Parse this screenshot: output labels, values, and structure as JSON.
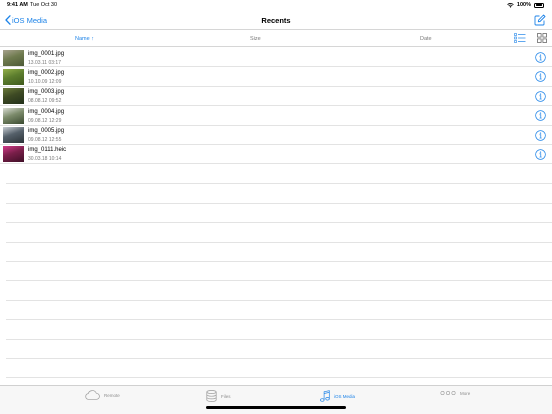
{
  "status_bar": {
    "time": "9:41 AM",
    "date": "Tue Oct 30",
    "battery": "100%",
    "battery_level": 1.0
  },
  "nav": {
    "back_label": "iOS Media",
    "title": "Recents"
  },
  "columns": {
    "name": "Name ↑",
    "size": "Size",
    "date": "Date"
  },
  "files": [
    {
      "name": "img_0001.jpg",
      "date": "13.03.11 03:17",
      "thumb_colors": [
        "#6f7b4f",
        "#a8a38f",
        "#4d5a36"
      ]
    },
    {
      "name": "img_0002.jpg",
      "date": "10.10.09 12:09",
      "thumb_colors": [
        "#5d7e2e",
        "#94b04a",
        "#3f5a1c"
      ]
    },
    {
      "name": "img_0003.jpg",
      "date": "08.08.12 09:52",
      "thumb_colors": [
        "#3e4a24",
        "#6a7a3a",
        "#22301a"
      ]
    },
    {
      "name": "img_0004.jpg",
      "date": "09.08.12 12:29",
      "thumb_colors": [
        "#7b8a6a",
        "#d9dcd3",
        "#3a4a30"
      ]
    },
    {
      "name": "img_0005.jpg",
      "date": "09.08.12 12:55",
      "thumb_colors": [
        "#55606a",
        "#c7cdd3",
        "#2c3338"
      ]
    },
    {
      "name": "img_0111.heic",
      "date": "30.03.18 10:14",
      "thumb_colors": [
        "#7a1f4a",
        "#d23a8a",
        "#3f0f27"
      ]
    }
  ],
  "tabs": [
    {
      "label": "Remote",
      "icon": "cloud-icon",
      "active": false
    },
    {
      "label": "Files",
      "icon": "database-icon",
      "active": false
    },
    {
      "label": "iOS Media",
      "icon": "music-note-icon",
      "active": true
    },
    {
      "label": "More",
      "icon": "more-dots-icon",
      "active": false
    }
  ],
  "colors": {
    "accent": "#1d83e8",
    "secondary_text": "#7a7a7a",
    "separator": "#e3e3e3"
  }
}
